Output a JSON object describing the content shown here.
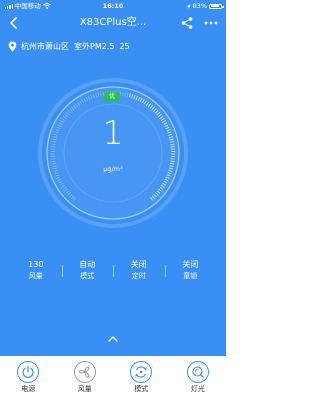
{
  "status_bar": {
    "carrier": "中国移动",
    "time": "16:10",
    "battery": "83%",
    "battery_level": 0.83
  },
  "header": {
    "title": "X83CPlus空..."
  },
  "location": {
    "city": "杭州市萧山区",
    "outdoor_label": "室外PM2.5",
    "outdoor_value": "25"
  },
  "gauge": {
    "quality_badge": "优",
    "value": "1",
    "unit": "μg/m³",
    "level": 0.02
  },
  "stats": [
    {
      "value": "130",
      "label": "风量"
    },
    {
      "value": "自动",
      "label": "模式"
    },
    {
      "value": "关闭",
      "label": "定时"
    },
    {
      "value": "关闭",
      "label": "童锁"
    }
  ],
  "controls": [
    {
      "label": "电源",
      "icon": "power-icon"
    },
    {
      "label": "风量",
      "icon": "fan-icon"
    },
    {
      "label": "模式",
      "icon": "mode-icon"
    },
    {
      "label": "灯光",
      "icon": "light-icon"
    }
  ],
  "colors": {
    "background": "#3a8ff4",
    "badge_good": "#28c24a",
    "bottom_bar": "#ffffff"
  }
}
